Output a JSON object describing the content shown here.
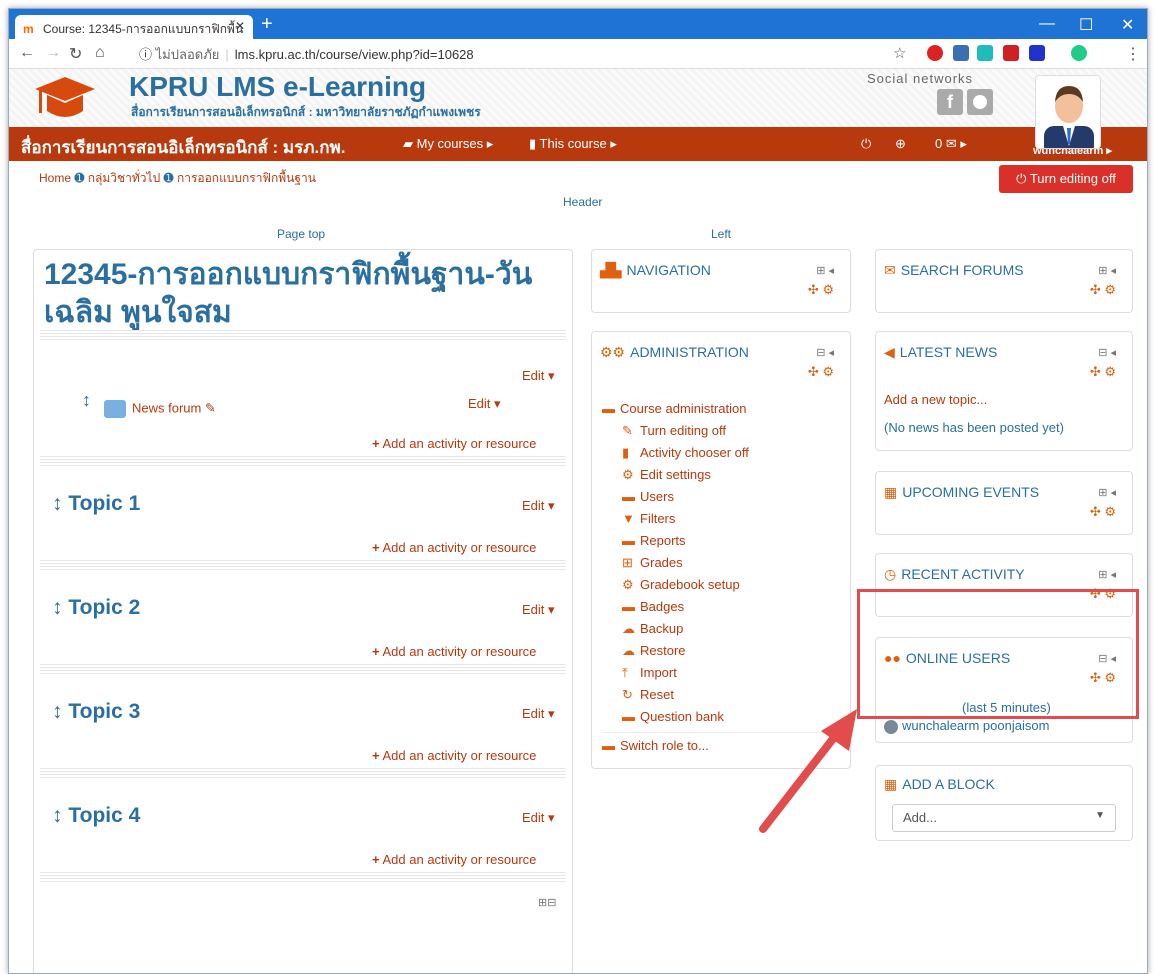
{
  "browser": {
    "tab_title": "Course: 12345-การออกแบบกราฟิกพื้น",
    "url_insecure": "ไม่ปลอดภัย",
    "url": "lms.kpru.ac.th/course/view.php?id=10628"
  },
  "site": {
    "name": "KPRU LMS e-Learning",
    "subtitle": "สื่อการเรียนการสอนอิเล็กทรอนิกส์ : มหาวิทยาลัยราชภัฏกำแพงเพชร",
    "social_label": "Social networks",
    "social_f": "f"
  },
  "navbar": {
    "brand": "สื่อการเรียนการสอนอิเล็กทรอนิกส์ : มรภ.กพ.",
    "my_courses": "My courses",
    "this_course": "This course",
    "messages_count": "0",
    "username": "wunchalearm"
  },
  "breadcrumb": [
    "Home",
    "กลุ่มวิชาทั่วไป",
    "การออกแบบกราฟิกพื้นฐาน"
  ],
  "edit_off_label": "Turn editing off",
  "regions": {
    "header": "Header",
    "page_top": "Page top",
    "left": "Left"
  },
  "course": {
    "title": "12345-การออกแบบกราฟิกพื้นฐาน-วันเฉลิม พูนใจสม",
    "news_forum": "News forum",
    "edit": "Edit",
    "add_activity": "Add an activity or resource",
    "topics": [
      "Topic 1",
      "Topic 2",
      "Topic 3",
      "Topic 4"
    ]
  },
  "blocks": {
    "navigation": "NAVIGATION",
    "administration": "ADMINISTRATION",
    "admin_items": [
      {
        "label": "Course administration",
        "icon": "folder-open-icon",
        "indent": false
      },
      {
        "label": "Turn editing off",
        "icon": "pencil-icon",
        "indent": true
      },
      {
        "label": "Activity chooser off",
        "icon": "file-icon",
        "indent": true
      },
      {
        "label": "Edit settings",
        "icon": "cogs-icon",
        "indent": true
      },
      {
        "label": "Users",
        "icon": "folder-icon",
        "indent": true
      },
      {
        "label": "Filters",
        "icon": "filter-icon",
        "indent": true
      },
      {
        "label": "Reports",
        "icon": "folder-icon",
        "indent": true
      },
      {
        "label": "Grades",
        "icon": "table-icon",
        "indent": true
      },
      {
        "label": "Gradebook setup",
        "icon": "cogs-icon",
        "indent": true
      },
      {
        "label": "Badges",
        "icon": "folder-icon",
        "indent": true
      },
      {
        "label": "Backup",
        "icon": "cloud-upload-icon",
        "indent": true
      },
      {
        "label": "Restore",
        "icon": "cloud-download-icon",
        "indent": true
      },
      {
        "label": "Import",
        "icon": "upload-icon",
        "indent": true
      },
      {
        "label": "Reset",
        "icon": "refresh-icon",
        "indent": true
      },
      {
        "label": "Question bank",
        "icon": "folder-icon",
        "indent": true
      }
    ],
    "switch_role": "Switch role to...",
    "search_forums": "SEARCH FORUMS",
    "latest_news": "LATEST NEWS",
    "add_topic": "Add a new topic...",
    "no_news": "(No news has been posted yet)",
    "upcoming_events": "UPCOMING EVENTS",
    "recent_activity": "RECENT ACTIVITY",
    "online_users": "ONLINE USERS",
    "last_minutes": "(last 5 minutes)",
    "online_user": "wunchalearm poonjaisom",
    "add_block": "ADD A BLOCK",
    "add_select": "Add..."
  },
  "colors": {
    "accent": "#b8390e",
    "link": "#2a6fa0",
    "highlight": "#e34c4c",
    "danger": "#d9312a"
  }
}
